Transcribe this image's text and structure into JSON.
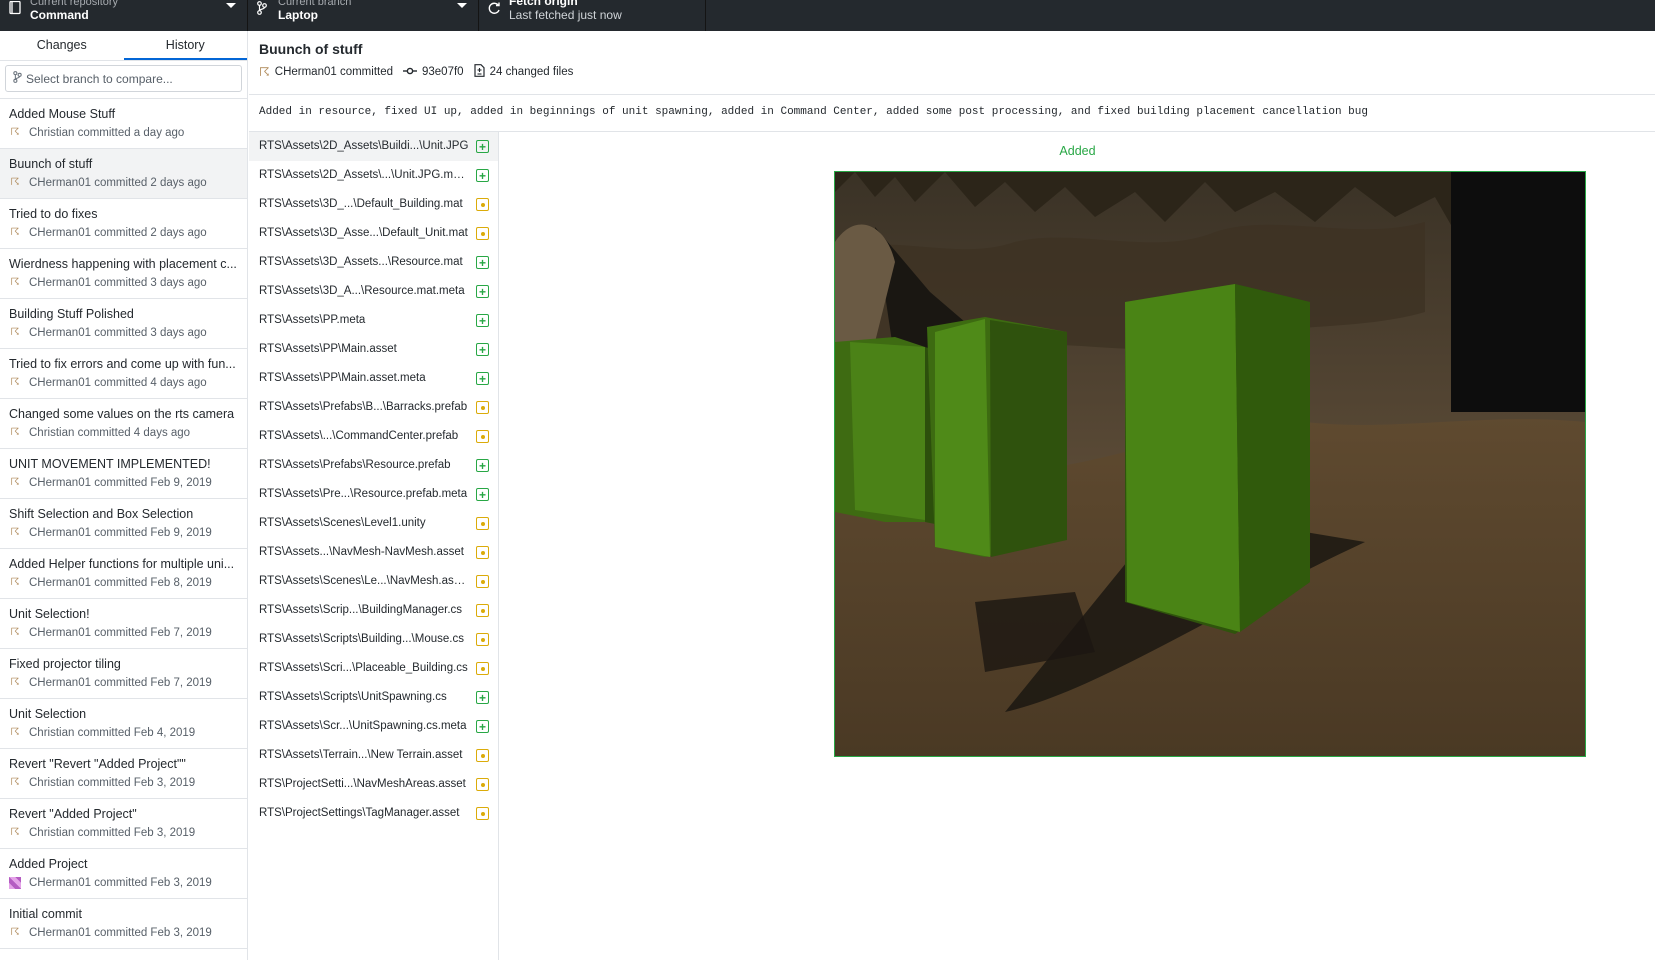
{
  "toolbar": {
    "repo_label": "Current repository",
    "repo_name": "Command",
    "branch_label": "Current branch",
    "branch_name": "Laptop",
    "fetch_label": "Fetch origin",
    "fetch_status": "Last fetched just now"
  },
  "sidebar": {
    "tabs": [
      "Changes",
      "History"
    ],
    "active_tab": "History",
    "compare_placeholder": "Select branch to compare...",
    "commits": [
      {
        "title": "Added Mouse Stuff",
        "meta": "Christian committed a day ago"
      },
      {
        "title": "Buunch of stuff",
        "meta": "CHerman01 committed 2 days ago",
        "selected": true
      },
      {
        "title": "Tried to do fixes",
        "meta": "CHerman01 committed 2 days ago"
      },
      {
        "title": "Wierdness happening with placement c...",
        "meta": "CHerman01 committed 3 days ago"
      },
      {
        "title": "Building Stuff Polished",
        "meta": "CHerman01 committed 3 days ago"
      },
      {
        "title": "Tried to fix errors and come up with fun...",
        "meta": "CHerman01 committed 4 days ago"
      },
      {
        "title": "Changed some values on the rts camera",
        "meta": "Christian committed 4 days ago"
      },
      {
        "title": "UNIT MOVEMENT IMPLEMENTED!",
        "meta": "CHerman01 committed Feb 9, 2019"
      },
      {
        "title": "Shift Selection and Box Selection",
        "meta": "CHerman01 committed Feb 9, 2019"
      },
      {
        "title": "Added Helper functions for multiple uni...",
        "meta": "CHerman01 committed Feb 8, 2019"
      },
      {
        "title": "Unit Selection!",
        "meta": "CHerman01 committed Feb 7, 2019"
      },
      {
        "title": "Fixed projector tiling",
        "meta": "CHerman01 committed Feb 7, 2019"
      },
      {
        "title": "Unit Selection",
        "meta": "Christian committed Feb 4, 2019"
      },
      {
        "title": "Revert \"Revert \"Added Project\"\"",
        "meta": "Christian committed Feb 3, 2019"
      },
      {
        "title": "Revert \"Added Project\"",
        "meta": "Christian committed Feb 3, 2019"
      },
      {
        "title": "Added Project",
        "meta": "CHerman01 committed Feb 3, 2019",
        "avatar": "mosaic"
      },
      {
        "title": "Initial commit",
        "meta": "CHerman01 committed Feb 3, 2019"
      }
    ]
  },
  "commit": {
    "title": "Buunch of stuff",
    "author": "CHerman01 committed",
    "sha": "93e07f0",
    "changed_files": "24 changed files",
    "description": "Added in resource, fixed UI up, added in beginnings of unit spawning, added in Command Center, added some post processing, and fixed building placement cancellation bug"
  },
  "files": [
    {
      "path": "RTS\\Assets\\2D_Assets\\Buildi...\\Unit.JPG",
      "status": "added",
      "selected": true
    },
    {
      "path": "RTS\\Assets\\2D_Assets\\...\\Unit.JPG.meta",
      "status": "added"
    },
    {
      "path": "RTS\\Assets\\3D_...\\Default_Building.mat",
      "status": "modified"
    },
    {
      "path": "RTS\\Assets\\3D_Asse...\\Default_Unit.mat",
      "status": "modified"
    },
    {
      "path": "RTS\\Assets\\3D_Assets...\\Resource.mat",
      "status": "added"
    },
    {
      "path": "RTS\\Assets\\3D_A...\\Resource.mat.meta",
      "status": "added"
    },
    {
      "path": "RTS\\Assets\\PP.meta",
      "status": "added"
    },
    {
      "path": "RTS\\Assets\\PP\\Main.asset",
      "status": "added"
    },
    {
      "path": "RTS\\Assets\\PP\\Main.asset.meta",
      "status": "added"
    },
    {
      "path": "RTS\\Assets\\Prefabs\\B...\\Barracks.prefab",
      "status": "modified"
    },
    {
      "path": "RTS\\Assets\\...\\CommandCenter.prefab",
      "status": "modified"
    },
    {
      "path": "RTS\\Assets\\Prefabs\\Resource.prefab",
      "status": "added"
    },
    {
      "path": "RTS\\Assets\\Pre...\\Resource.prefab.meta",
      "status": "added"
    },
    {
      "path": "RTS\\Assets\\Scenes\\Level1.unity",
      "status": "modified"
    },
    {
      "path": "RTS\\Assets...\\NavMesh-NavMesh.asset",
      "status": "modified"
    },
    {
      "path": "RTS\\Assets\\Scenes\\Le...\\NavMesh.asset",
      "status": "modified"
    },
    {
      "path": "RTS\\Assets\\Scrip...\\BuildingManager.cs",
      "status": "modified"
    },
    {
      "path": "RTS\\Assets\\Scripts\\Building...\\Mouse.cs",
      "status": "modified"
    },
    {
      "path": "RTS\\Assets\\Scri...\\Placeable_Building.cs",
      "status": "modified"
    },
    {
      "path": "RTS\\Assets\\Scripts\\UnitSpawning.cs",
      "status": "added"
    },
    {
      "path": "RTS\\Assets\\Scr...\\UnitSpawning.cs.meta",
      "status": "added"
    },
    {
      "path": "RTS\\Assets\\Terrain...\\New Terrain.asset",
      "status": "modified"
    },
    {
      "path": "RTS\\ProjectSetti...\\NavMeshAreas.asset",
      "status": "modified"
    },
    {
      "path": "RTS\\ProjectSettings\\TagManager.asset",
      "status": "modified"
    }
  ],
  "diff": {
    "label": "Added"
  },
  "colors": {
    "toolbar_bg": "#24292e",
    "accent": "#0366d6",
    "added": "#28a745",
    "modified": "#dbab09"
  }
}
